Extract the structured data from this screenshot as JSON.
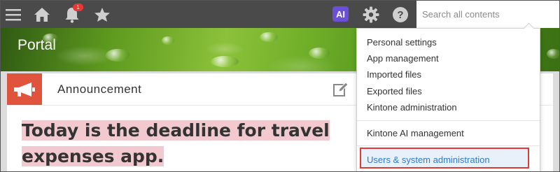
{
  "topbar": {
    "icons": [
      "menu-icon",
      "home-icon",
      "bell-icon",
      "star-icon",
      "gear-icon",
      "help-icon"
    ],
    "notification_count": "1",
    "ai_label": "AI",
    "search_placeholder": "Search all contents"
  },
  "banner": {
    "title": "Portal"
  },
  "announcement": {
    "title": "Announcement",
    "headline_line1": "Today is the deadline for travel",
    "headline_line2": "expenses app."
  },
  "menu": {
    "items": [
      "Personal settings",
      "App management",
      "Imported files",
      "Exported files",
      "Kintone administration",
      "Kintone AI management",
      "Users & system administration"
    ],
    "highlighted_color": "#e53935"
  }
}
